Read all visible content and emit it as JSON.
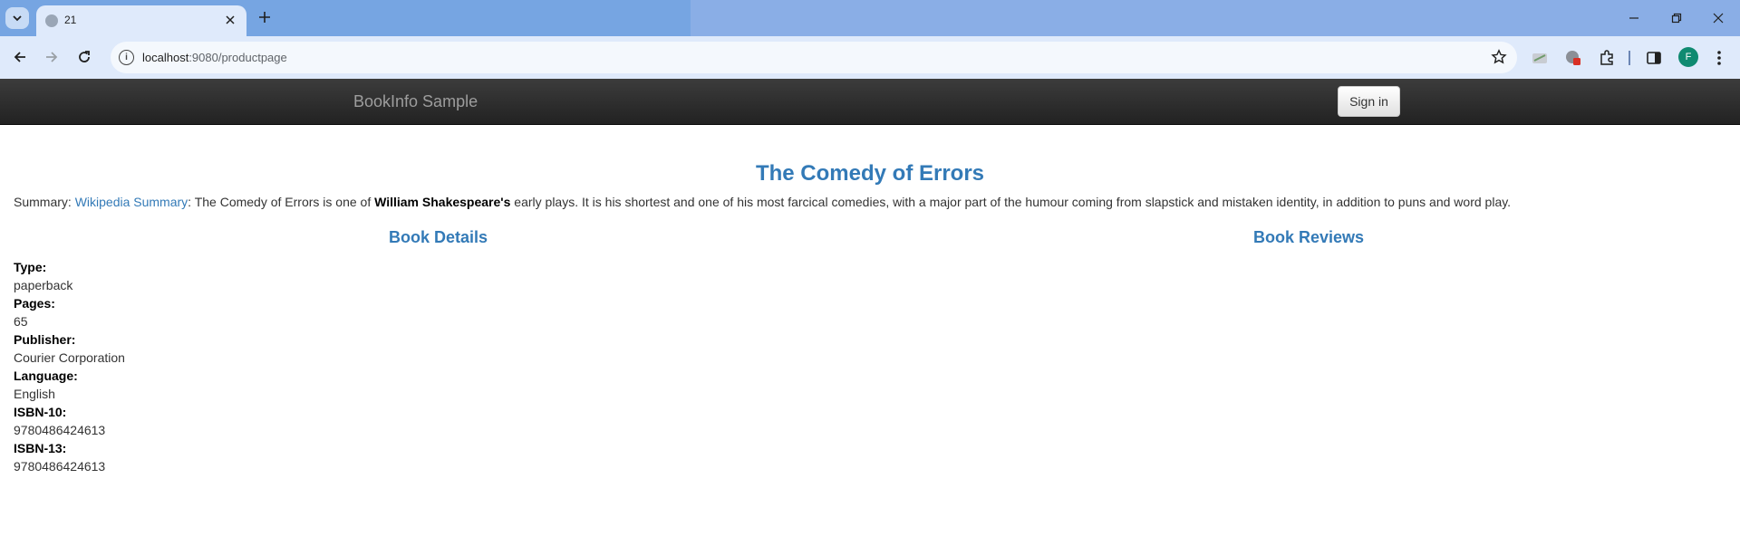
{
  "browser": {
    "tab_title": "21",
    "url_host": "localhost",
    "url_rest": ":9080/productpage",
    "profile_initial": "F"
  },
  "navbar": {
    "brand": "BookInfo Sample",
    "signin_label": "Sign in"
  },
  "book": {
    "title": "The Comedy of Errors",
    "summary_prefix": "Summary: ",
    "summary_link": "Wikipedia Summary",
    "summary_part1": ": The Comedy of Errors is one of ",
    "summary_bold": "William Shakespeare's",
    "summary_part2": " early plays. It is his shortest and one of his most farcical comedies, with a major part of the humour coming from slapstick and mistaken identity, in addition to puns and word play."
  },
  "sections": {
    "details_heading": "Book Details",
    "reviews_heading": "Book Reviews"
  },
  "details": [
    {
      "label": "Type:",
      "value": "paperback"
    },
    {
      "label": "Pages:",
      "value": "65"
    },
    {
      "label": "Publisher:",
      "value": "Courier Corporation"
    },
    {
      "label": "Language:",
      "value": "English"
    },
    {
      "label": "ISBN-10:",
      "value": "9780486424613"
    },
    {
      "label": "ISBN-13:",
      "value": "9780486424613"
    }
  ],
  "colors": {
    "link": "#337ab7",
    "navbar": "#222222",
    "brand": "#9d9d9d"
  }
}
